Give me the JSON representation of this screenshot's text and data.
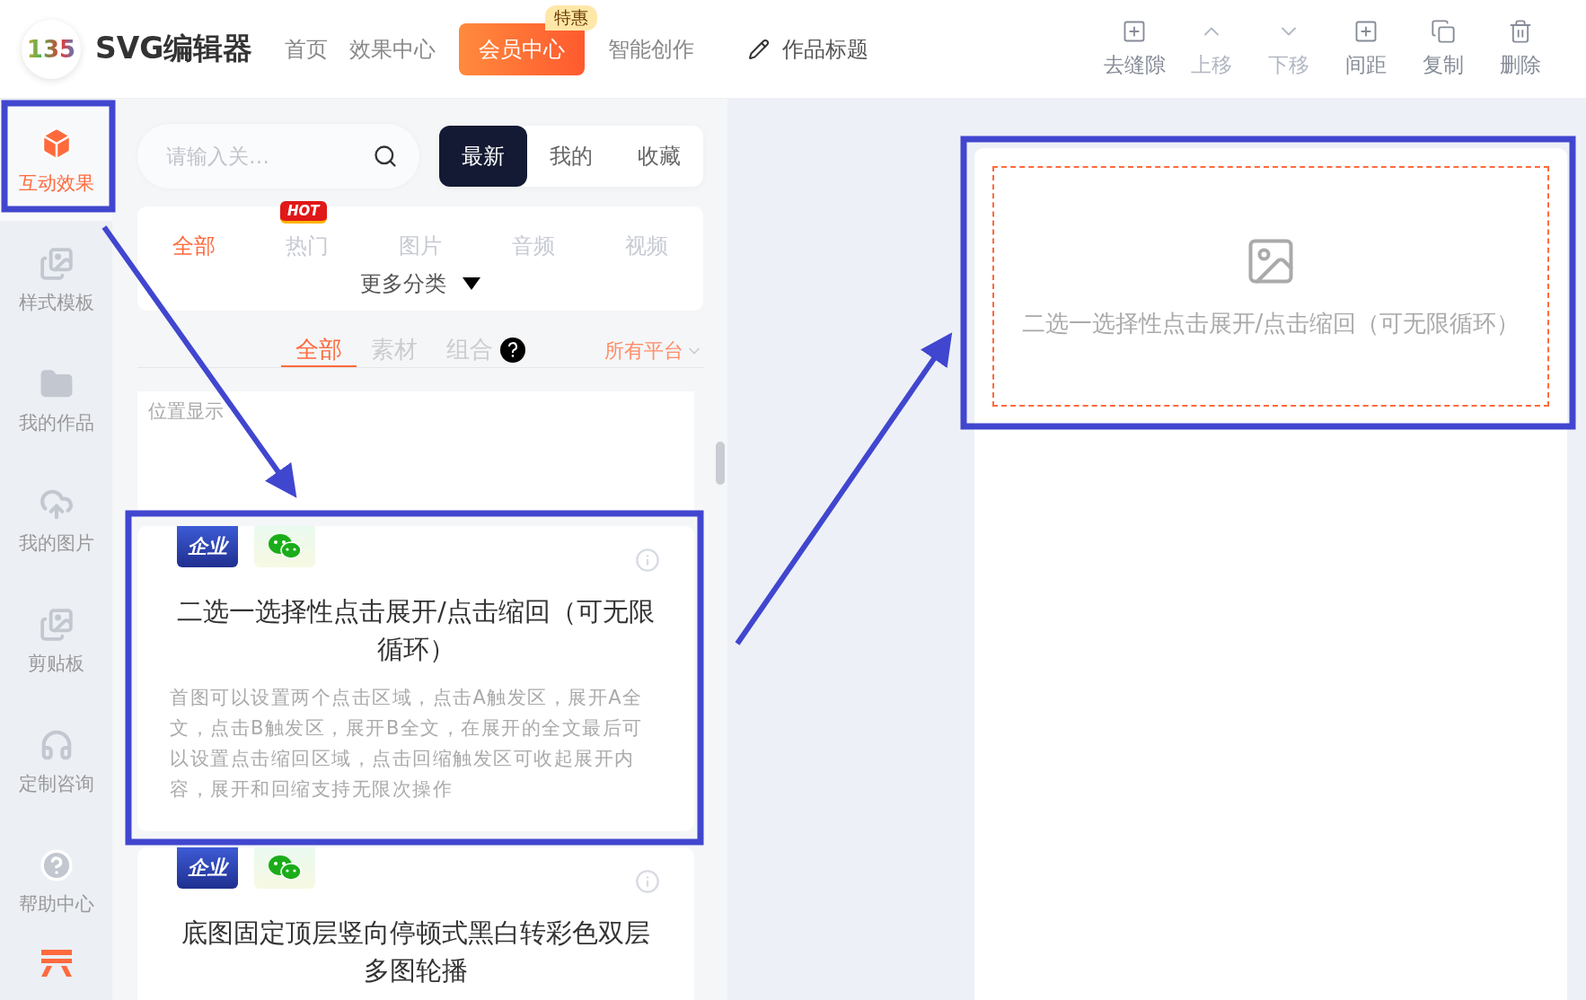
{
  "header": {
    "logo_mark": "135",
    "logo_text": "SVG编辑器",
    "nav": [
      {
        "label": "首页",
        "kind": "link"
      },
      {
        "label": "效果中心",
        "kind": "link"
      },
      {
        "label": "会员中心",
        "kind": "promo",
        "badge": "特惠"
      },
      {
        "label": "智能创作",
        "kind": "link"
      }
    ],
    "title_field": {
      "value": "作品标题"
    },
    "tools": [
      {
        "label": "去缝隙",
        "disabled": false
      },
      {
        "label": "上移",
        "disabled": true
      },
      {
        "label": "下移",
        "disabled": true
      },
      {
        "label": "间距",
        "disabled": false
      },
      {
        "label": "复制",
        "disabled": false
      },
      {
        "label": "删除",
        "disabled": false
      }
    ]
  },
  "sidebar": {
    "items": [
      {
        "label": "互动效果",
        "selected": true
      },
      {
        "label": "样式模板",
        "selected": false
      },
      {
        "label": "我的作品",
        "selected": false
      },
      {
        "label": "我的图片",
        "selected": false
      },
      {
        "label": "剪贴板",
        "selected": false
      },
      {
        "label": "定制咨询",
        "selected": false
      },
      {
        "label": "帮助中心",
        "selected": false
      }
    ]
  },
  "panel": {
    "search": {
      "placeholder": "请输入关…"
    },
    "sort_tabs": [
      {
        "label": "最新",
        "selected": true
      },
      {
        "label": "我的",
        "selected": false
      },
      {
        "label": "收藏",
        "selected": false
      }
    ],
    "categories": [
      {
        "label": "全部",
        "selected": true
      },
      {
        "label": "热门",
        "selected": false,
        "badge": "HOT"
      },
      {
        "label": "图片",
        "selected": false
      },
      {
        "label": "音频",
        "selected": false
      },
      {
        "label": "视频",
        "selected": false
      }
    ],
    "more_categories": "更多分类",
    "sub_tabs": [
      {
        "label": "全部",
        "selected": true
      },
      {
        "label": "素材",
        "selected": false
      },
      {
        "label": "组合",
        "selected": false,
        "help": true
      }
    ],
    "platform": "所有平台",
    "cards": [
      {
        "kind": "partial",
        "title": "位置显示"
      },
      {
        "kind": "full",
        "tag": "企业",
        "title": "二选一选择性点击展开/点击缩回（可无限循环）",
        "description": "首图可以设置两个点击区域，点击A触发区，展开A全文，点击B触发区，展开B全文，在展开的全文最后可以设置点击缩回区域，点击回缩触发区可收起展开内容，展开和回缩支持无限次操作"
      },
      {
        "kind": "full",
        "tag": "企业",
        "title": "底图固定顶层竖向停顿式黑白转彩色双层多图轮播"
      }
    ]
  },
  "canvas": {
    "placeholder_text": "二选一选择性点击展开/点击缩回（可无限循环）"
  }
}
